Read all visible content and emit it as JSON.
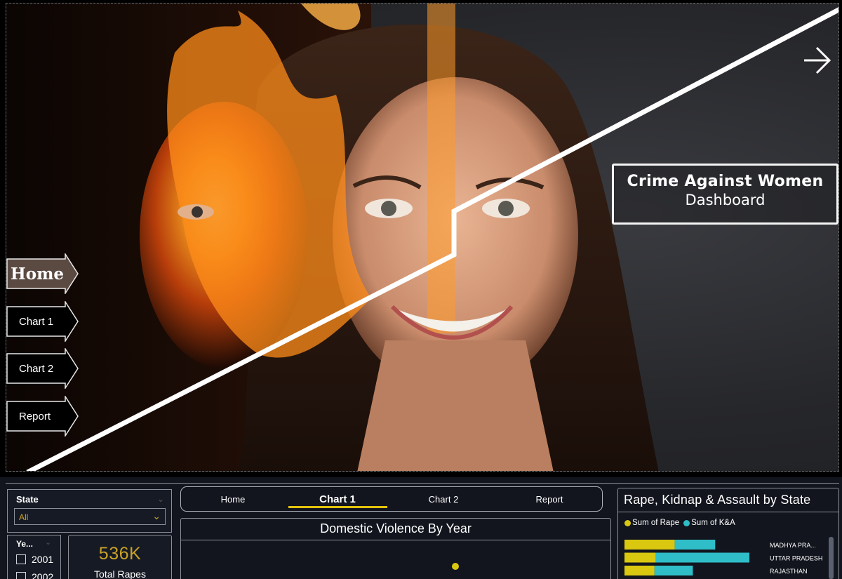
{
  "hero": {
    "title": "Crime Against Women",
    "subtitle": "Dashboard",
    "next_icon": "arrow-right-icon",
    "nav": [
      {
        "label": "Home"
      },
      {
        "label": "Chart 1"
      },
      {
        "label": "Chart 2"
      },
      {
        "label": "Report"
      }
    ]
  },
  "filters": {
    "state": {
      "title": "State",
      "selected": "All"
    },
    "year": {
      "title": "Ye...",
      "items": [
        "2001",
        "2002"
      ]
    }
  },
  "kpi": {
    "value": "536K",
    "label": "Total Rapes"
  },
  "tabs": {
    "items": [
      "Home",
      "Chart 1",
      "Chart 2",
      "Report"
    ],
    "active": "Chart 1"
  },
  "domestic_violence": {
    "title": "Domestic Violence By Year"
  },
  "state_chart": {
    "title": "Rape, Kidnap & Assault by State",
    "chart_data": {
      "type": "bar",
      "orientation": "horizontal",
      "stacked": true,
      "categories": [
        "MADHYA PRA...",
        "UTTAR PRADESH",
        "RAJASTHAN"
      ],
      "series": [
        {
          "name": "Sum of Rape",
          "color": "#d9c80f",
          "values": [
            72,
            45,
            43
          ]
        },
        {
          "name": "Sum of K&A",
          "color": "#2fbec8",
          "values": [
            58,
            134,
            55
          ]
        }
      ],
      "legend": "top-left"
    }
  },
  "colors": {
    "accent": "#e2c20c",
    "kpi": "#c9a227",
    "teal": "#2fbec8",
    "panel": "#12151e"
  }
}
